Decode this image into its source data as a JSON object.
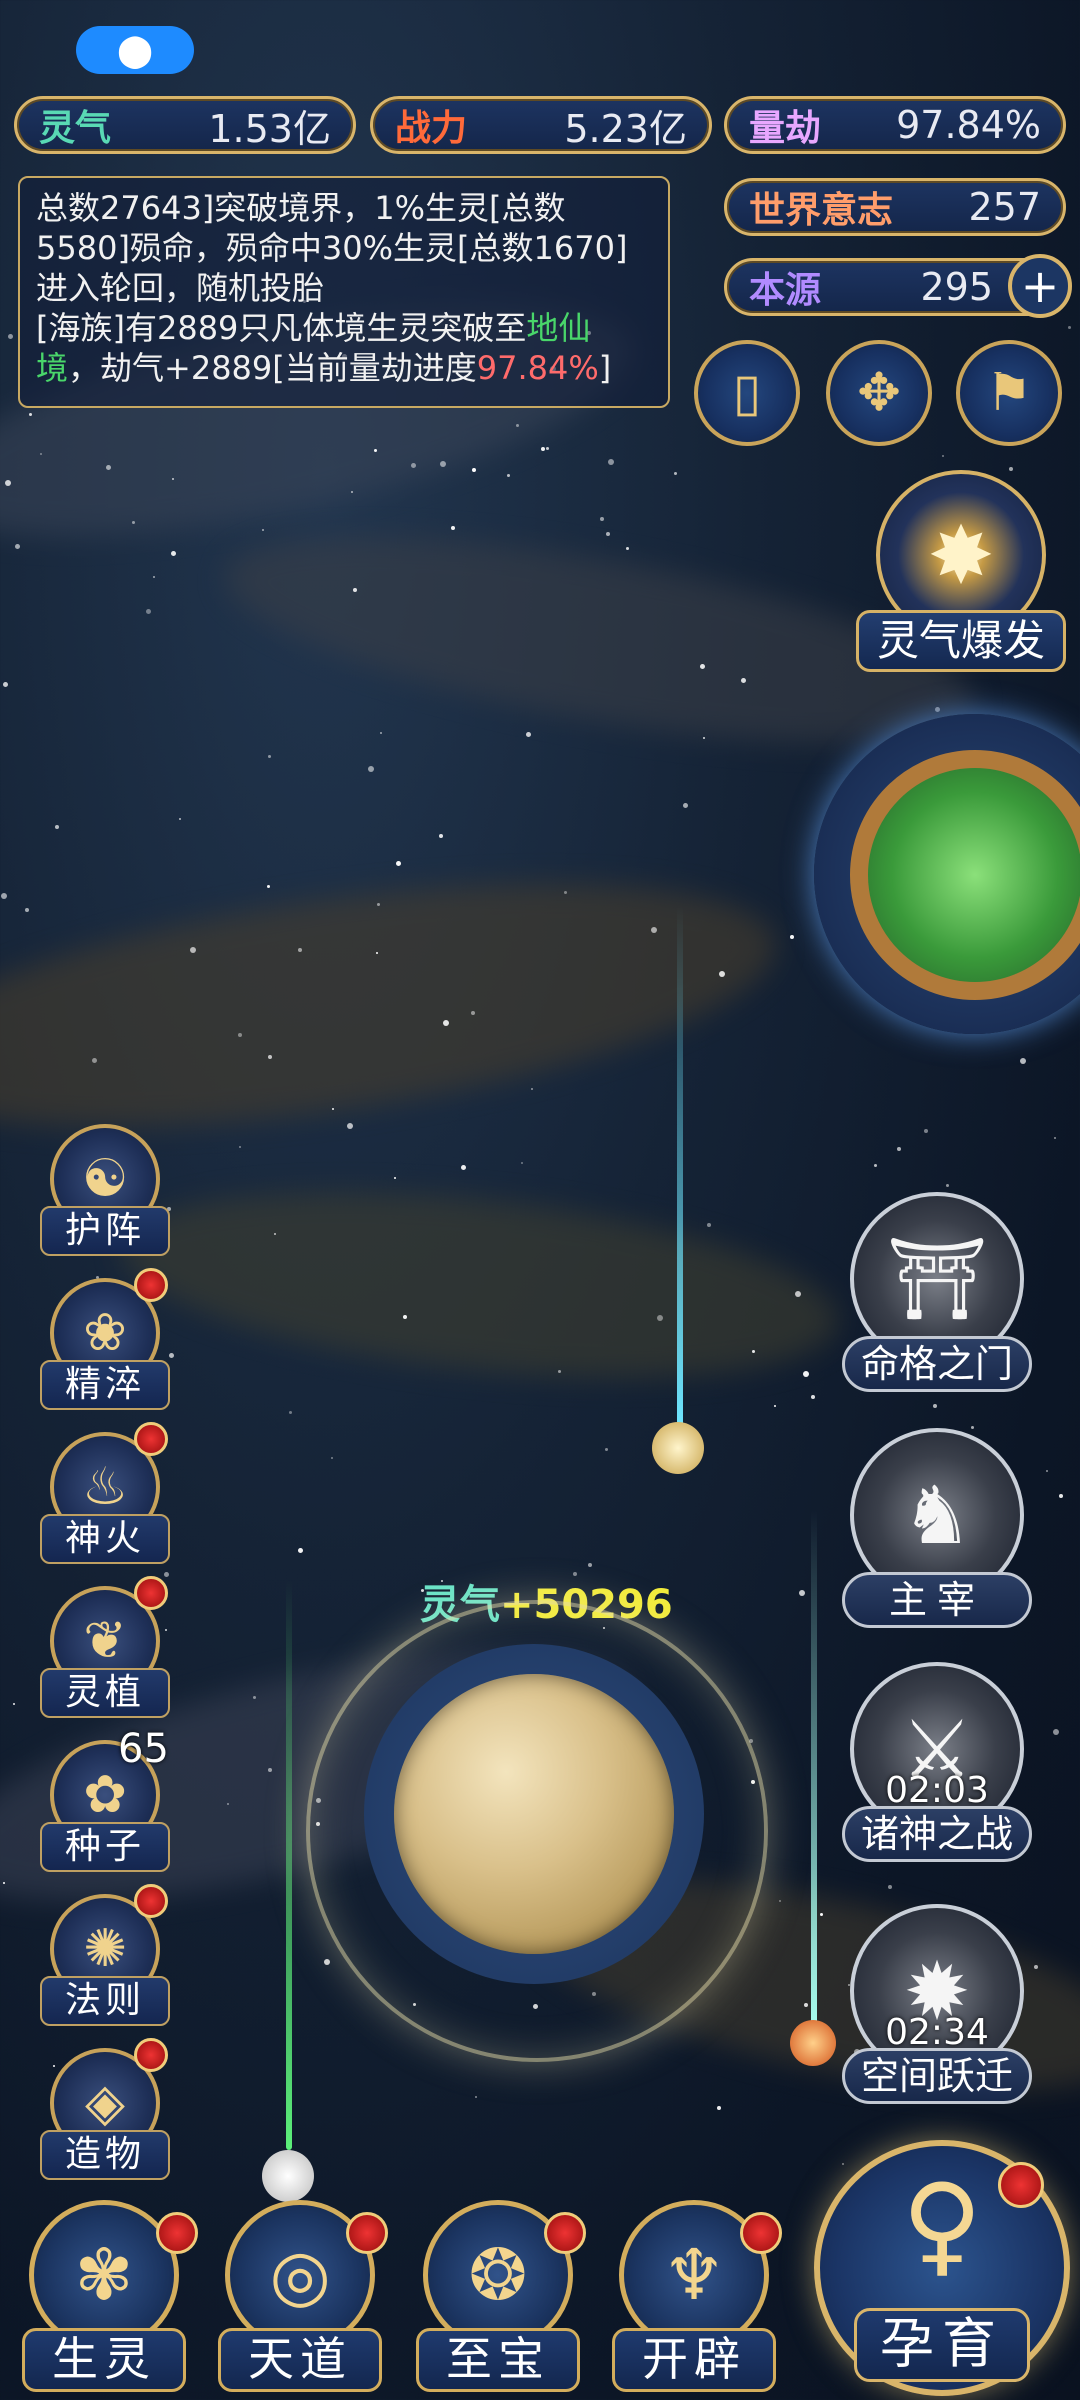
{
  "resources": {
    "lingqi": {
      "label": "灵气",
      "value": "1.53亿"
    },
    "zhanli": {
      "label": "战力",
      "value": "5.23亿"
    },
    "liangjie": {
      "label": "量劫",
      "value": "97.84%"
    },
    "world_will": {
      "label": "世界意志",
      "value": "257"
    },
    "benyuan": {
      "label": "本源",
      "value": "295"
    }
  },
  "log": {
    "line1": "总数27643]突破境界，1%生灵[总数5580]殒命，殒命中30%生灵[总数1670]进入轮回，随机投胎",
    "line2_a": "[海族]有2889只凡体境生灵突破至",
    "line2_realm": "地仙境",
    "line2_b": "，劫气+2889[当前量劫进度",
    "line2_progress": "97.84%",
    "line2_c": "]"
  },
  "burst_label": "灵气爆发",
  "gain_label": "灵气",
  "gain_value": "+50296",
  "left_features": [
    {
      "label": "护阵",
      "icon": "☯"
    },
    {
      "label": "精淬",
      "icon": "❀"
    },
    {
      "label": "神火",
      "icon": "♨"
    },
    {
      "label": "灵植",
      "icon": "❦"
    },
    {
      "label": "种子",
      "icon": "✿",
      "count": "65"
    },
    {
      "label": "法则",
      "icon": "✺"
    },
    {
      "label": "造物",
      "icon": "◈"
    }
  ],
  "right_features": [
    {
      "label": "命格之门",
      "icon": "⛩"
    },
    {
      "label": "主宰",
      "icon": "♞"
    },
    {
      "label": "诸神之战",
      "icon": "⚔",
      "timer": "02:03"
    },
    {
      "label": "空间跃迁",
      "icon": "✹",
      "timer": "02:34"
    }
  ],
  "bottom_nav": [
    {
      "label": "生灵",
      "icon": "✾"
    },
    {
      "label": "天道",
      "icon": "◎"
    },
    {
      "label": "至宝",
      "icon": "❂"
    },
    {
      "label": "开辟",
      "icon": "♆"
    }
  ],
  "main_button": {
    "label": "孕育",
    "icon": "♀"
  },
  "colors": {
    "gold": "#d9b56a",
    "realm_green": "#49d66a",
    "progress_red": "#ff6b6b",
    "gain_yellow": "#f2ec3c"
  }
}
